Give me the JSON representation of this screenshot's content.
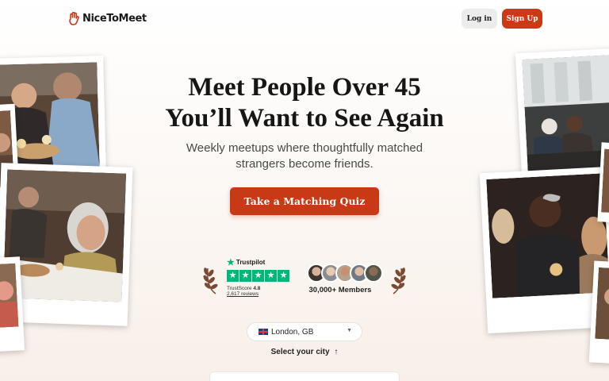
{
  "header": {
    "brand": "NiceToMeet",
    "login_label": "Log in",
    "signup_label": "Sign Up"
  },
  "hero": {
    "headline_line1": "Meet People Over 45",
    "headline_line2": "You’ll Want to See Again",
    "subtitle": "Weekly meetups where thoughtfully matched strangers become friends.",
    "cta_label": "Take a Matching Quiz"
  },
  "trust": {
    "trustpilot_name": "Trustpilot",
    "trustscore_label": "TrustScore",
    "trustscore_value": "4.8",
    "reviews": "2,617 reviews",
    "rating_stars": 5,
    "members": "30,000+ Members"
  },
  "city": {
    "flag": "🇬🇧",
    "value": "London, GB",
    "helper": "Select your city",
    "helper_icon": "↑"
  },
  "icons": {
    "logo": "waving-hand-icon",
    "laurel": "laurel-wreath-icon",
    "caret": "chevron-down-icon"
  },
  "colors": {
    "brand": "#cc3a14",
    "trustpilot": "#00b67a"
  }
}
